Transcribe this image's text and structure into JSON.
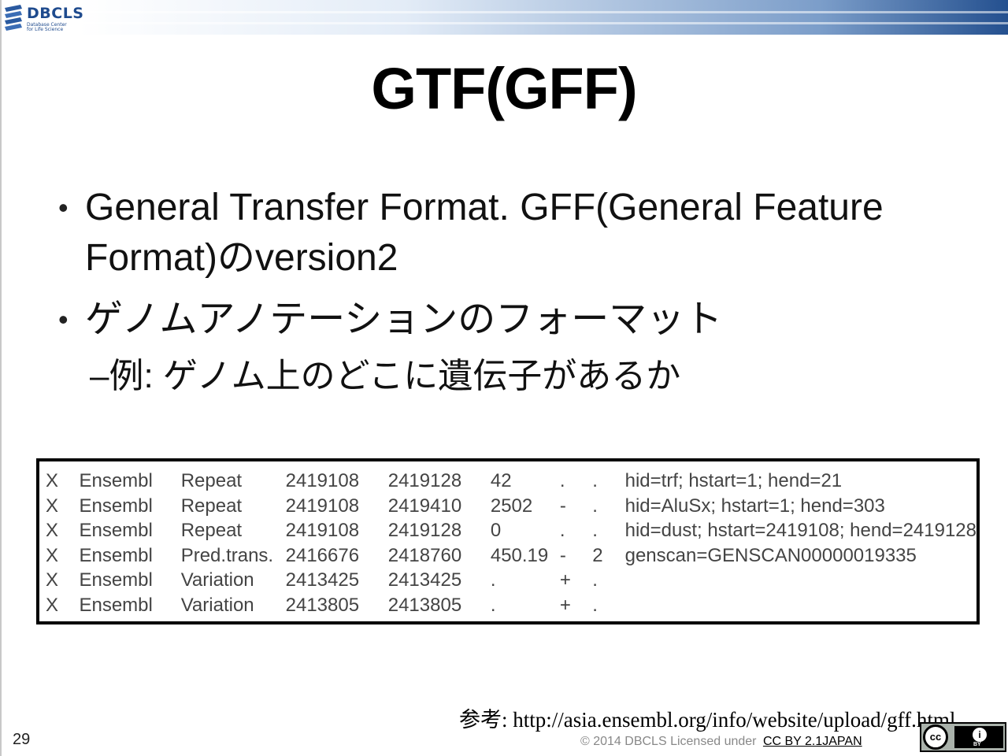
{
  "header": {
    "logo_name": "DBCLS",
    "logo_sub_line1": "Database Center",
    "logo_sub_line2": "for Life Science"
  },
  "slide": {
    "title": "GTF(GFF)",
    "bullets": [
      {
        "text": "General Transfer Format. GFF(General Feature Format)のversion2"
      },
      {
        "text": "ゲノムアノテーションのフォーマット"
      }
    ],
    "sub_bullet": "–例: ゲノム上のどこに遺伝子があるか"
  },
  "gtf_rows": [
    [
      "X",
      "Ensembl",
      "Repeat",
      "2419108",
      "2419128",
      "42",
      ".",
      ".",
      "hid=trf; hstart=1; hend=21"
    ],
    [
      "X",
      "Ensembl",
      "Repeat",
      "2419108",
      "2419410",
      "2502",
      "-",
      ".",
      "hid=AluSx; hstart=1; hend=303"
    ],
    [
      "X",
      "Ensembl",
      "Repeat",
      "2419108",
      "2419128",
      "0",
      ".",
      ".",
      "hid=dust; hstart=2419108; hend=2419128"
    ],
    [
      "X",
      "Ensembl",
      "Pred.trans.",
      "2416676",
      "2418760",
      "450.19",
      "-",
      "2",
      "genscan=GENSCAN00000019335"
    ],
    [
      "X",
      "Ensembl",
      "Variation",
      "2413425",
      "2413425",
      ".",
      "+",
      ".",
      ""
    ],
    [
      "X",
      "Ensembl",
      "Variation",
      "2413805",
      "2413805",
      ".",
      "+",
      ".",
      ""
    ]
  ],
  "reference": "参考: http://asia.ensembl.org/info/website/upload/gff.html",
  "footer": {
    "page_number": "29",
    "license_text": "© 2014 DBCLS Licensed under",
    "license_link": "CC BY 2.1JAPAN",
    "cc_label": "cc",
    "by_label": "BY",
    "by_icon": "i"
  }
}
